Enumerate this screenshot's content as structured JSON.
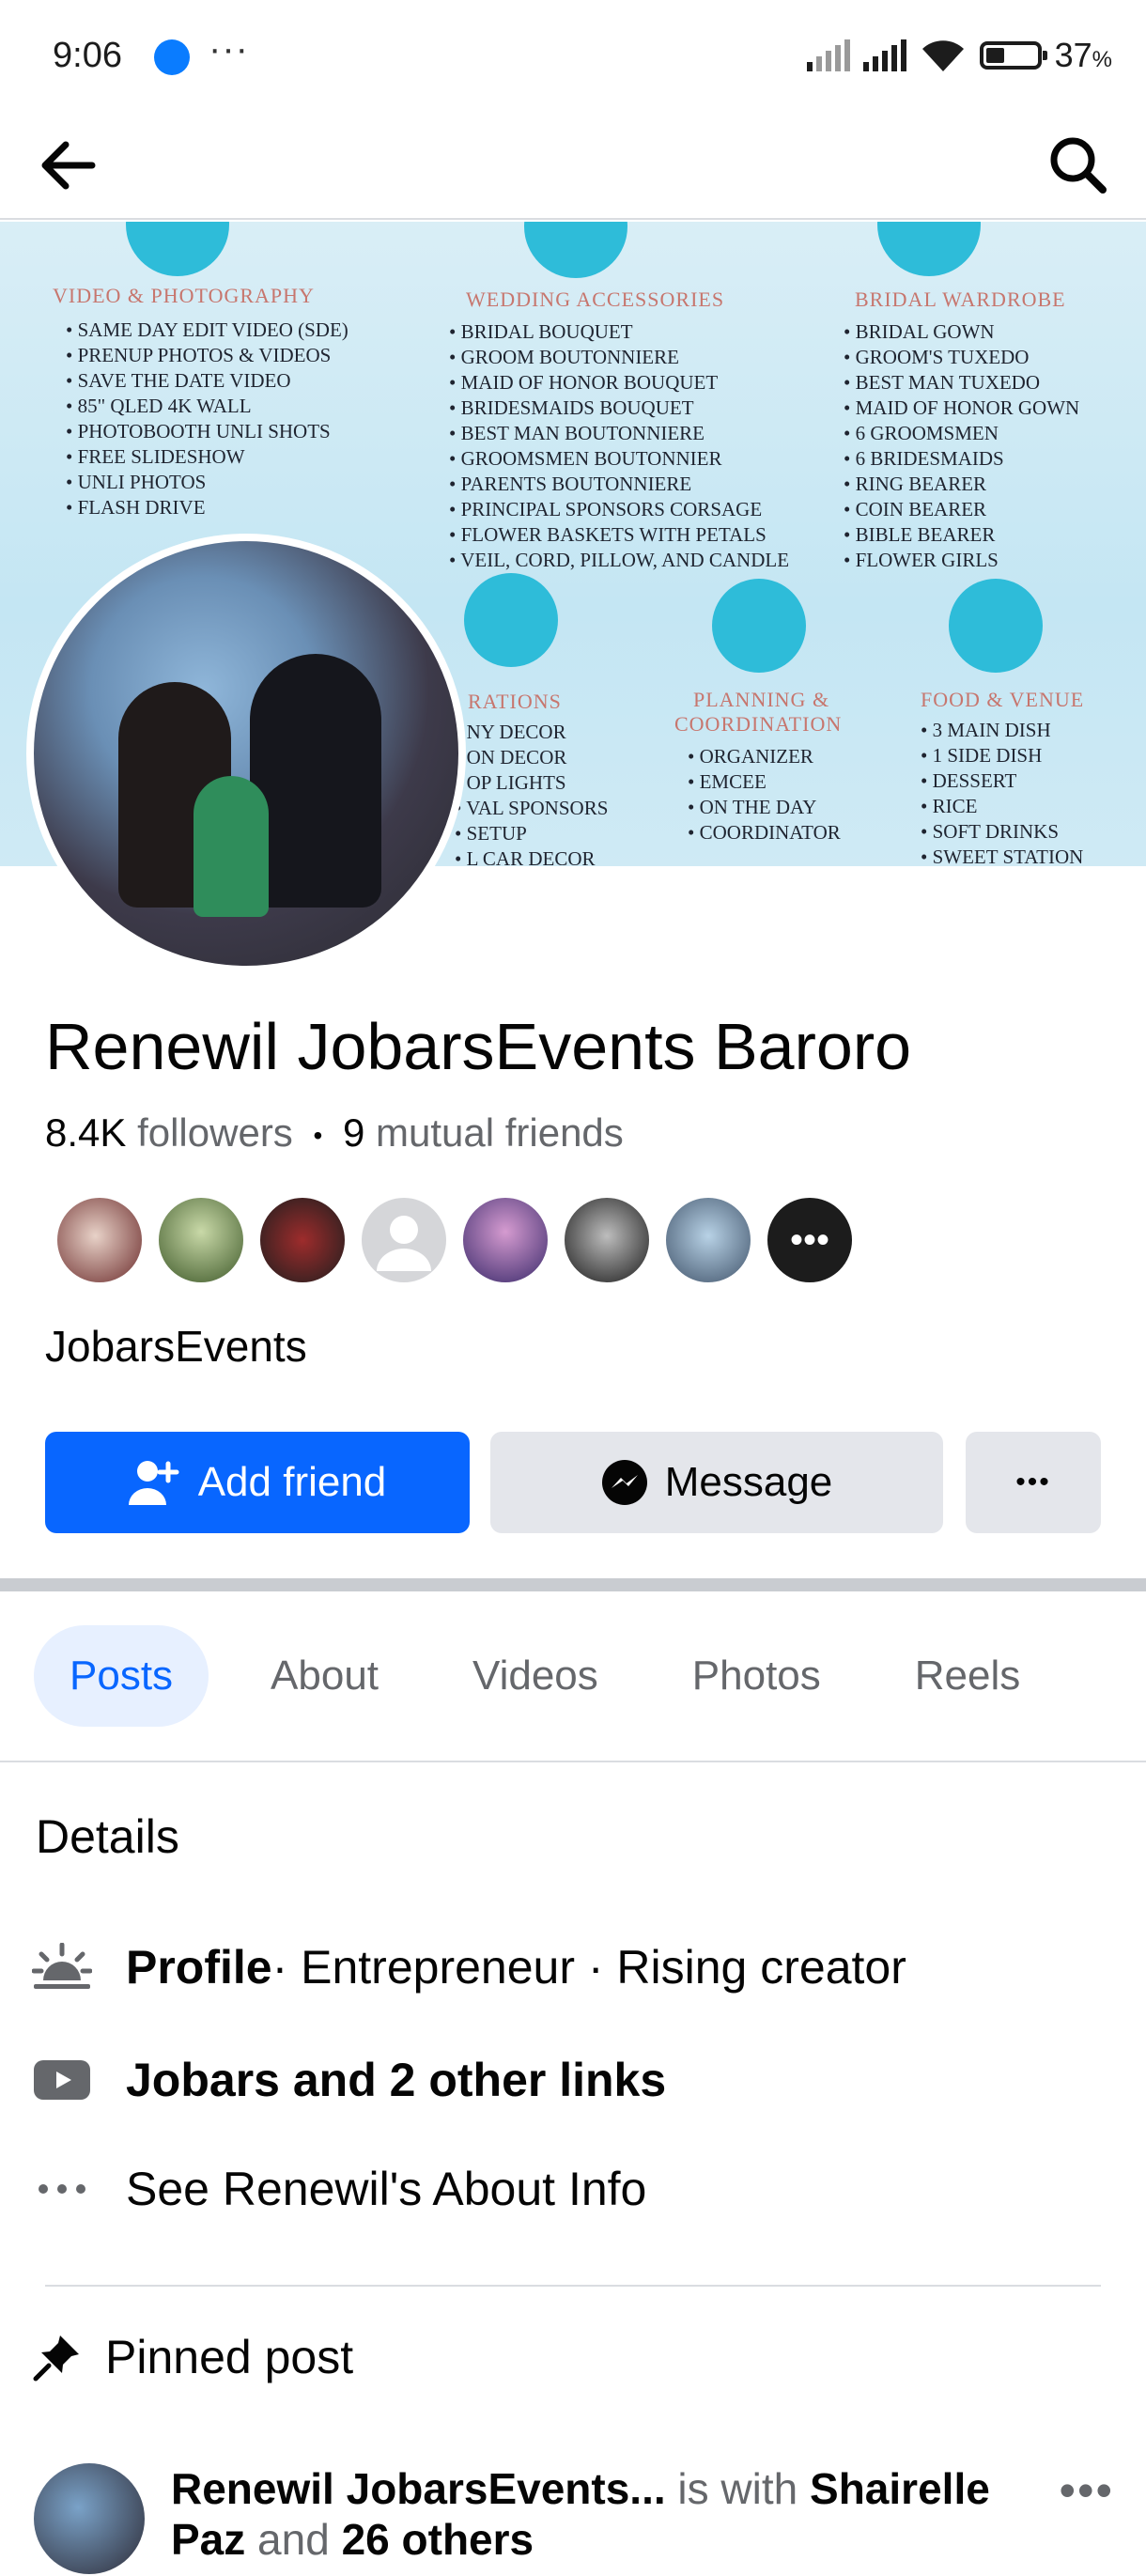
{
  "status_bar": {
    "time": "9:06",
    "more": "···",
    "battery": "37",
    "battery_unit": "%",
    "battery_level": 0.37
  },
  "nav": {
    "back_icon": "arrow-left-icon",
    "search_icon": "search-icon"
  },
  "cover": {
    "columns": [
      {
        "heading": "VIDEO & PHOTOGRAPHY",
        "icon": "camera-icon",
        "items": [
          "SAME DAY EDIT VIDEO (SDE)",
          "PRENUP PHOTOS & VIDEOS",
          "SAVE THE DATE VIDEO",
          "85\" QLED 4K WALL",
          "PHOTOBOOTH UNLI SHOTS",
          "FREE SLIDESHOW",
          "UNLI PHOTOS",
          "FLASH DRIVE"
        ]
      },
      {
        "heading": "WEDDING ACCESSORIES",
        "icon": "bouquet-icon",
        "items": [
          "BRIDAL BOUQUET",
          "GROOM BOUTONNIERE",
          "MAID OF HONOR BOUQUET",
          "BRIDESMAIDS BOUQUET",
          "BEST MAN BOUTONNIERE",
          "GROOMSMEN BOUTONNIER",
          "PARENTS BOUTONNIERE",
          "PRINCIPAL SPONSORS CORSAGE",
          "FLOWER BASKETS WITH PETALS",
          "VEIL, CORD, PILLOW, AND CANDLE"
        ]
      },
      {
        "heading": "BRIDAL WARDROBE",
        "icon": "gown-icon",
        "items": [
          "BRIDAL GOWN",
          "GROOM'S TUXEDO",
          "BEST MAN TUXEDO",
          "MAID OF HONOR GOWN",
          "6 GROOMSMEN",
          "6 BRIDESMAIDS",
          "RING BEARER",
          "COIN BEARER",
          "BIBLE BEARER",
          "FLOWER GIRLS"
        ]
      },
      {
        "heading": "RATIONS",
        "icon": "bunting-icon",
        "items": [
          "NY DECOR",
          "ON DECOR",
          "OP LIGHTS",
          "VAL SPONSORS",
          "SETUP",
          "L CAR DECOR"
        ]
      },
      {
        "heading": "PLANNING &",
        "heading2": "COORDINATION",
        "icon": "clipboard-icon",
        "items": [
          "ORGANIZER",
          "EMCEE",
          "ON THE DAY",
          "COORDINATOR"
        ]
      },
      {
        "heading": "FOOD & VENUE",
        "icon": "plate-icon",
        "items": [
          "3 MAIN DISH",
          "1 SIDE DISH",
          "DESSERT",
          "RICE",
          "SOFT DRINKS",
          "SWEET STATION"
        ]
      }
    ]
  },
  "profile": {
    "name": "Renewil JobarsEvents Baroro",
    "followers_count": "8.4K",
    "followers_label": "followers",
    "dot": "•",
    "mutual_count": "9",
    "mutual_label": "mutual friends",
    "bio": "JobarsEvents",
    "friend_more": "•••"
  },
  "actions": {
    "add_friend": "Add friend",
    "message": "Message",
    "more": "•••"
  },
  "tabs": [
    "Posts",
    "About",
    "Videos",
    "Photos",
    "Reels"
  ],
  "details": {
    "heading": "Details",
    "profile_label": "Profile",
    "profile_rest": " · Entrepreneur · Rising creator",
    "links": "Jobars and 2 other links",
    "about": "See Renewil's About Info"
  },
  "pinned": {
    "heading": "Pinned post",
    "author": "Renewil JobarsEvents...",
    "is_with": " is with ",
    "tagged": "Shairelle",
    "tagged2": "Paz",
    "and": " and ",
    "others": "26 others",
    "more": "•••"
  },
  "colors": {
    "accent": "#0866ff",
    "tab_active_bg": "#e7f0ff",
    "button_grey": "#e4e6eb",
    "muted": "#65676b"
  }
}
